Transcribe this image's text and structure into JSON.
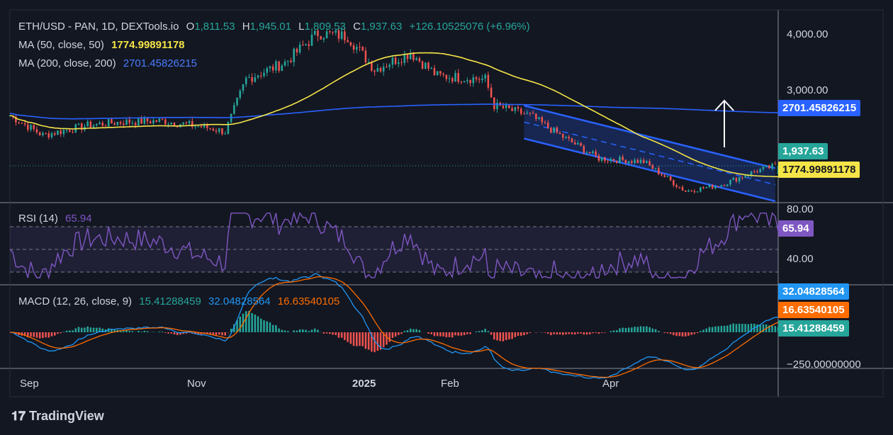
{
  "legend": {
    "symbol": "ETH/USD - PAN, 1D, DEXTools.io",
    "o_label": "O",
    "o_val": "1,811.53",
    "h_label": "H",
    "h_val": "1,945.01",
    "l_label": "L",
    "l_val": "1,809.53",
    "c_label": "C",
    "c_val": "1,937.63",
    "change": "+126.10525076 (+6.96%)",
    "ma50_label": "MA (50, close, 50)",
    "ma50_val": "1774.99891178",
    "ma200_label": "MA (200, close, 200)",
    "ma200_val": "2701.45826215",
    "rsi_label": "RSI (14)",
    "rsi_val": "65.94",
    "macd_label": "MACD (12, 26, close, 9)",
    "macd_hist": "15.41288459",
    "macd_line": "32.04828564",
    "macd_signal": "16.63540105"
  },
  "price_axis": {
    "ticks": [
      "4,000.00",
      "3,000.00"
    ]
  },
  "rsi_axis": {
    "ticks": [
      "80.00",
      "40.00"
    ]
  },
  "macd_axis": {
    "ticks": [
      "−250.00000000"
    ]
  },
  "tags": {
    "ma200": "2701.45826215",
    "close": "1,937.63",
    "ma50": "1774.99891178",
    "rsi": "65.94",
    "macd": "32.04828564",
    "signal": "16.63540105",
    "hist": "15.41288459"
  },
  "x_axis": [
    "Sep",
    "Nov",
    "2025",
    "Feb",
    "Apr"
  ],
  "brand": "TradingView",
  "colors": {
    "bg": "#131722",
    "up": "#26a69a",
    "down": "#ef5350",
    "ma50": "#f5e447",
    "ma200": "#2962ff",
    "rsi": "#7e57c2",
    "macd": "#2196f3",
    "signal": "#ff6d00",
    "channel": "#2962ff"
  },
  "chart_data": [
    {
      "type": "candlestick",
      "title": "ETH/USD - PAN, 1D, DEXTools.io",
      "x_range": [
        "2024-08-25",
        "2025-05-09"
      ],
      "y_range": [
        1400,
        4300
      ],
      "price_keypoints": {
        "dates": [
          "2024-08-25",
          "2024-09-05",
          "2024-09-20",
          "2024-10-01",
          "2024-10-15",
          "2024-11-01",
          "2024-11-05",
          "2024-11-12",
          "2024-11-25",
          "2024-12-06",
          "2024-12-16",
          "2024-12-25",
          "2025-01-06",
          "2025-01-15",
          "2025-01-31",
          "2025-02-03",
          "2025-02-15",
          "2025-02-25",
          "2025-03-10",
          "2025-03-25",
          "2025-04-08",
          "2025-04-20",
          "2025-05-01",
          "2025-05-08"
        ],
        "close": [
          2700,
          2400,
          2550,
          2600,
          2620,
          2500,
          2450,
          3250,
          3500,
          3950,
          3900,
          3400,
          3650,
          3300,
          3250,
          2850,
          2700,
          2400,
          2050,
          2000,
          1550,
          1650,
          1850,
          1937.63
        ]
      },
      "last_candle": {
        "open": 1811.53,
        "high": 1945.01,
        "low": 1809.53,
        "close": 1937.63,
        "change": 126.10525076,
        "change_pct": 6.96
      },
      "series": [
        {
          "name": "MA (50, close, 50)",
          "last": 1774.99891178
        },
        {
          "name": "MA (200, close, 200)",
          "last": 2701.45826215
        }
      ],
      "annotations": [
        "descending channel Feb–Apr 2025",
        "upward arrow"
      ]
    },
    {
      "type": "line",
      "title": "RSI (14)",
      "y_range": [
        20,
        90
      ],
      "levels": [
        70,
        50,
        30
      ],
      "last": 65.94
    },
    {
      "type": "line",
      "title": "MACD (12, 26, close, 9)",
      "series": [
        {
          "name": "MACD",
          "last": 32.04828564
        },
        {
          "name": "Signal",
          "last": 16.63540105
        },
        {
          "name": "Histogram",
          "last": 15.41288459
        }
      ]
    }
  ]
}
